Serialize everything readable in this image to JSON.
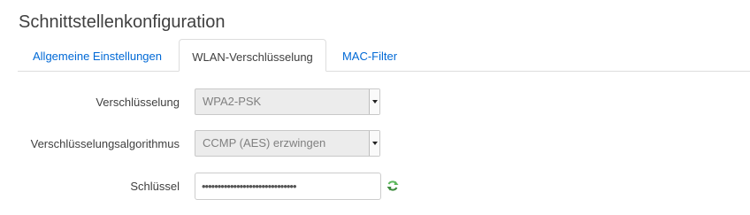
{
  "page": {
    "title": "Schnittstellenkonfiguration"
  },
  "tabs": [
    {
      "label": "Allgemeine Einstellungen"
    },
    {
      "label": "WLAN-Verschlüsselung"
    },
    {
      "label": "MAC-Filter"
    }
  ],
  "form": {
    "encryption": {
      "label": "Verschlüsselung",
      "value": "WPA2-PSK"
    },
    "cipher": {
      "label": "Verschlüsselungsalgorithmus",
      "value": "CCMP (AES) erzwingen"
    },
    "key": {
      "label": "Schlüssel",
      "masked_value": "••••••••••••••••••••••••••••••"
    }
  },
  "icons": {
    "reveal": "refresh-icon"
  },
  "colors": {
    "link": "#0069d6",
    "refresh_icon": "#5cb85c"
  }
}
